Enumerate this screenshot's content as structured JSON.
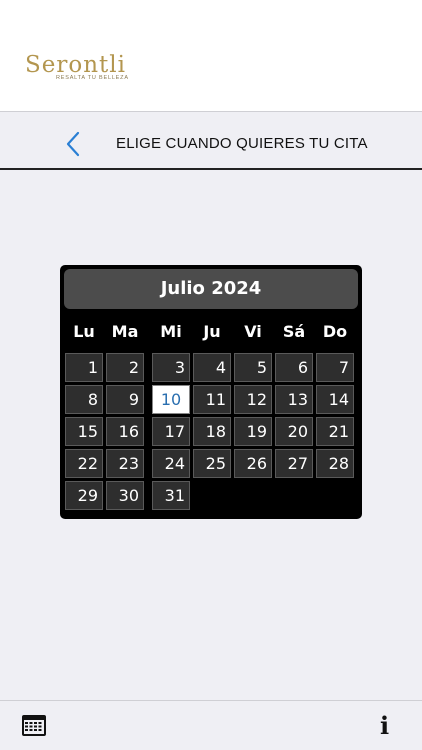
{
  "brand": {
    "logo_text": "Serontli",
    "tagline": "RESALTA TU BELLEZA",
    "color": "#b3964f"
  },
  "header": {
    "title": "ELIGE CUANDO QUIERES TU CITA",
    "back_icon": "chevron-left-icon"
  },
  "calendar": {
    "month_label": "Julio 2024",
    "weekdays": [
      "Lu",
      "Ma",
      "Mi",
      "Ju",
      "Vi",
      "Sá",
      "Do"
    ],
    "days": [
      "1",
      "2",
      "3",
      "4",
      "5",
      "6",
      "7",
      "8",
      "9",
      "10",
      "11",
      "12",
      "13",
      "14",
      "15",
      "16",
      "17",
      "18",
      "19",
      "20",
      "21",
      "22",
      "23",
      "24",
      "25",
      "26",
      "27",
      "28",
      "29",
      "30",
      "31"
    ],
    "selected_day": "10"
  },
  "footer": {
    "left_icon": "calendar-icon",
    "right_icon": "info-icon",
    "info_glyph": "i"
  },
  "colors": {
    "background": "#efeff4",
    "accent": "#2a6fb0"
  }
}
